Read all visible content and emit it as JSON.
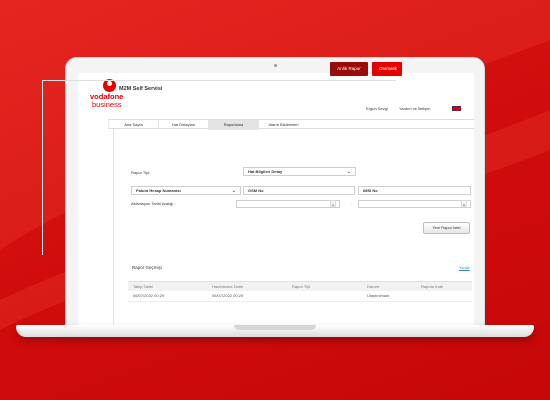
{
  "app": {
    "logo_text": "vodafone",
    "logo_sub": "business",
    "title": "M2M Self Servisi",
    "user": "Ergun Sevgi",
    "help": "Yardım ve İletişim"
  },
  "nav": {
    "tabs": [
      {
        "label": "Ana Sayfa",
        "selected": false
      },
      {
        "label": "Hat Detayları",
        "selected": false
      },
      {
        "label": "Raporlama",
        "selected": true
      },
      {
        "label": "Alarm Bildirimleri",
        "selected": false
      }
    ]
  },
  "actions": {
    "primary_label": "Anlık Rapor",
    "secondary_label": "Otomatik"
  },
  "form": {
    "report_type_label": "Rapor Tipi:",
    "report_type_value": "Hat Bilgileri Detay",
    "account_select": "Fatura Hesap Numarası",
    "gsm_placeholder": "GSM No",
    "imsi_placeholder": "IMSI No",
    "date_label": "Aktivasyon Tarihi Aralığı :",
    "date_separator": "-",
    "clear_glyph": "x",
    "new_report_label": "Yeni Rapor İstet"
  },
  "history": {
    "title": "Rapor Geçmişi",
    "refresh_label": "Yenile",
    "columns": [
      "Talep Tarihi",
      "Hazırlanma Tarihi",
      "Rapor Tipi",
      "Durum",
      "Raporu İndir"
    ],
    "rows": [
      [
        "06/07/2022 00:29",
        "06/07/2022 00:29",
        "",
        "Ulaştırılmadı",
        ""
      ]
    ]
  },
  "colors": {
    "brand_red": "#e60000",
    "dark_red": "#9b0b0b",
    "background_red": "#d40a0a"
  }
}
